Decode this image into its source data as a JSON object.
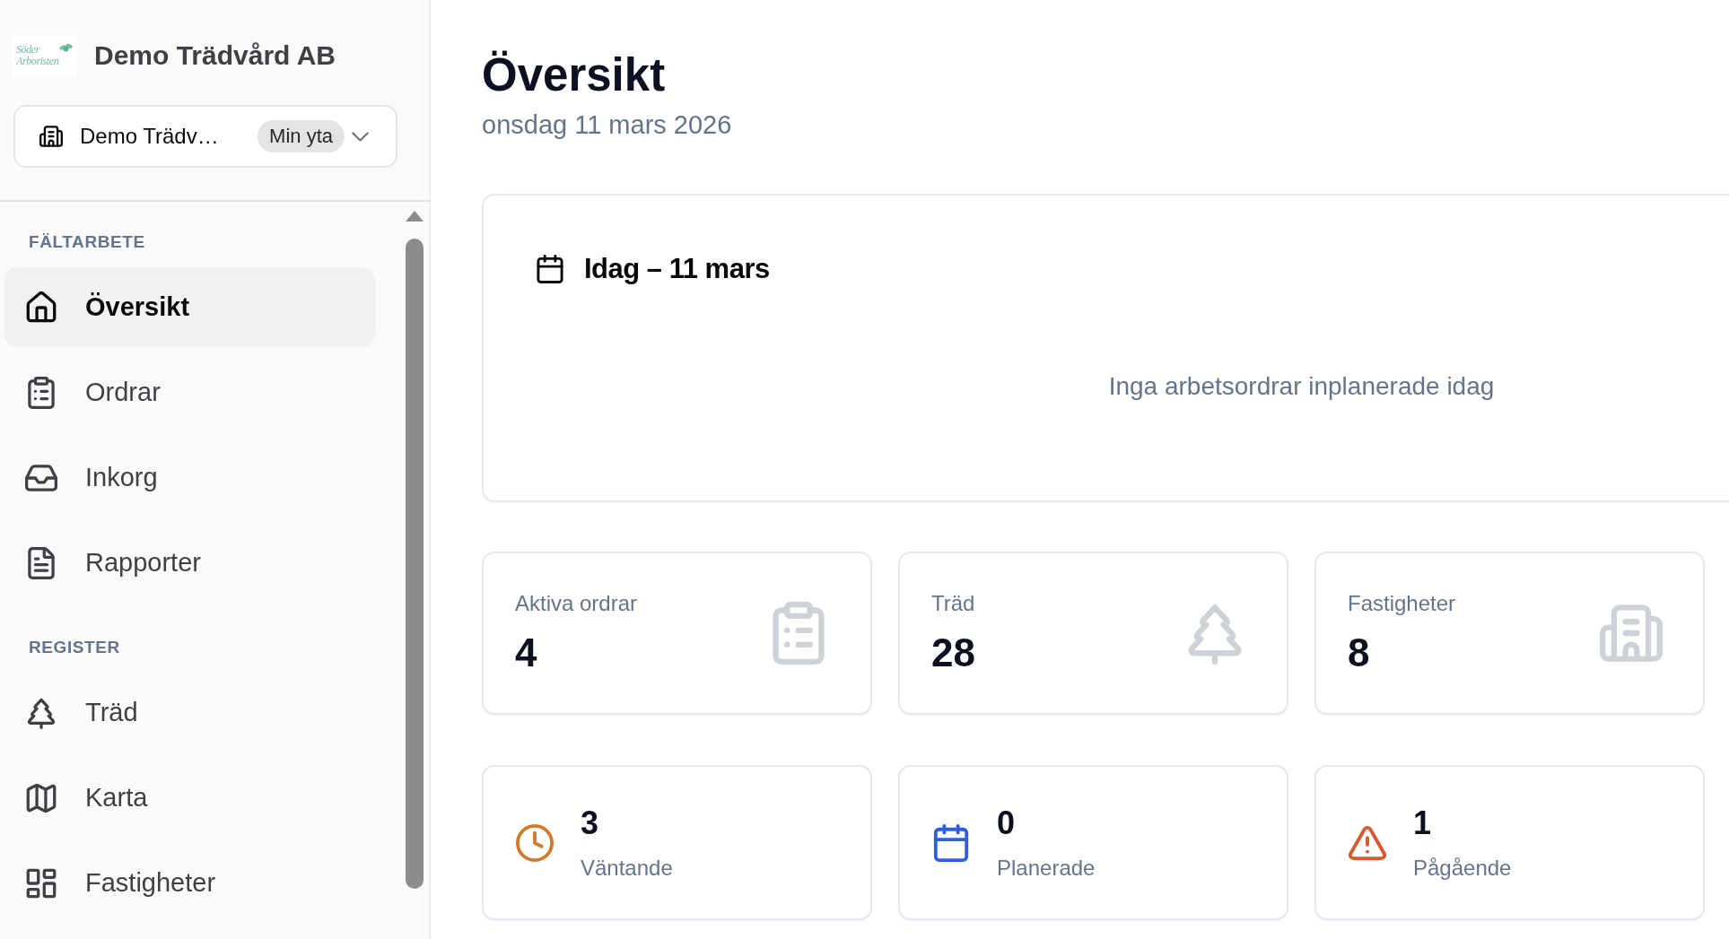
{
  "sidebar": {
    "logo": {
      "lines": [
        "Söder",
        "Arboristen"
      ]
    },
    "company": "Demo Trädvård AB",
    "workspace": {
      "name": "Demo Trädv…",
      "tag": "Min yta"
    },
    "sections": [
      {
        "label": "FÄLTARBETE",
        "items": [
          {
            "label": "Översikt",
            "selected": true
          },
          {
            "label": "Ordrar",
            "selected": false
          },
          {
            "label": "Inkorg",
            "selected": false
          },
          {
            "label": "Rapporter",
            "selected": false
          }
        ]
      },
      {
        "label": "REGISTER",
        "items": [
          {
            "label": "Träd",
            "selected": false
          },
          {
            "label": "Karta",
            "selected": false
          },
          {
            "label": "Fastigheter",
            "selected": false
          }
        ]
      }
    ]
  },
  "page": {
    "title": "Översikt",
    "date": "onsdag 11 mars 2026"
  },
  "today": {
    "title": "Idag – 11 mars",
    "empty_message": "Inga arbetsordrar inplanerade idag"
  },
  "stats": [
    {
      "label": "Aktiva ordrar",
      "value": "4"
    },
    {
      "label": "Träd",
      "value": "28"
    },
    {
      "label": "Fastigheter",
      "value": "8"
    }
  ],
  "status_counts": [
    {
      "value": "3",
      "label": "Väntande",
      "color": "#d07b2c"
    },
    {
      "value": "0",
      "label": "Planerade",
      "color": "#2f5fe0"
    },
    {
      "value": "1",
      "label": "Pågående",
      "color": "#d9592b"
    }
  ]
}
